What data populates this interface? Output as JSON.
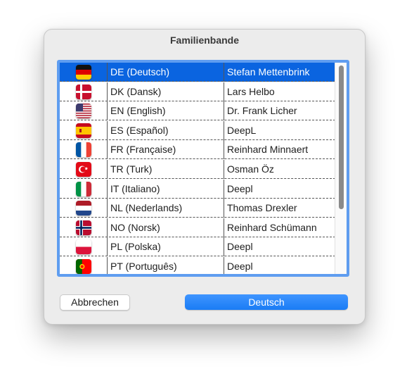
{
  "window": {
    "title": "Familienbande"
  },
  "rows": [
    {
      "flag": "flag-de-icon",
      "language": "DE (Deutsch)",
      "translator": "Stefan Mettenbrink",
      "selected": true
    },
    {
      "flag": "flag-dk-icon",
      "language": "DK (Dansk)",
      "translator": "Lars Helbo"
    },
    {
      "flag": "flag-en-icon",
      "language": "EN (English)",
      "translator": "Dr. Frank Licher"
    },
    {
      "flag": "flag-es-icon",
      "language": "ES (Español)",
      "translator": "DeepL"
    },
    {
      "flag": "flag-fr-icon",
      "language": "FR (Française)",
      "translator": "Reinhard Minnaert"
    },
    {
      "flag": "flag-tr-icon",
      "language": "TR (Turk)",
      "translator": "Osman Öz"
    },
    {
      "flag": "flag-it-icon",
      "language": "IT (Italiano)",
      "translator": "Deepl"
    },
    {
      "flag": "flag-nl-icon",
      "language": "NL (Nederlands)",
      "translator": "Thomas Drexler"
    },
    {
      "flag": "flag-no-icon",
      "language": "NO (Norsk)",
      "translator": "Reinhard Schümann"
    },
    {
      "flag": "flag-pl-icon",
      "language": "PL (Polska)",
      "translator": "Deepl"
    },
    {
      "flag": "flag-pt-icon",
      "language": "PT (Português)",
      "translator": "Deepl"
    }
  ],
  "buttons": {
    "cancel": "Abbrechen",
    "confirm": "Deutsch"
  },
  "colors": {
    "selection": "#0a64e0",
    "accent": "#1a7cf5",
    "frame": "#5f9df0"
  }
}
